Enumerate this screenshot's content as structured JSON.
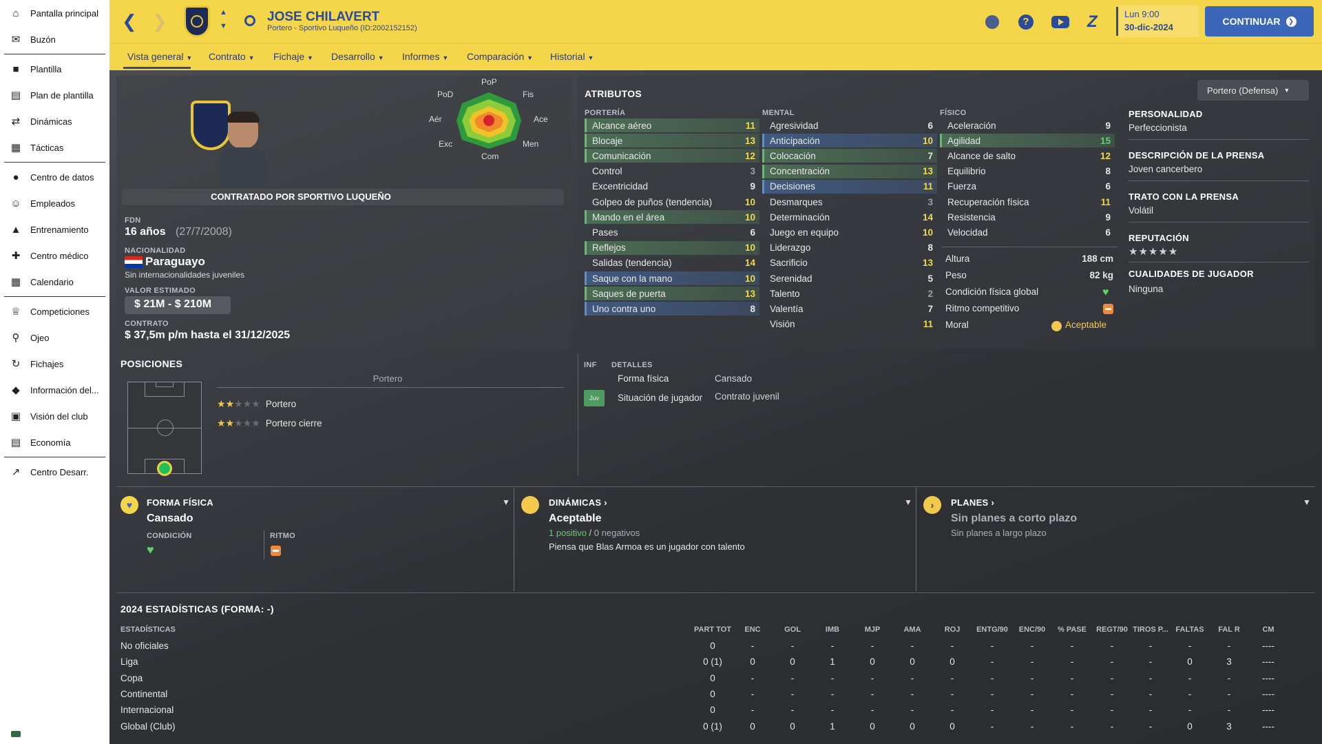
{
  "sidebar": {
    "items": [
      {
        "label": "Pantalla principal",
        "icon": "home-icon"
      },
      {
        "label": "Buzón",
        "icon": "inbox-icon"
      },
      {
        "label": "Plantilla",
        "icon": "shirt-icon"
      },
      {
        "label": "Plan de plantilla",
        "icon": "clipboard-icon"
      },
      {
        "label": "Dinámicas",
        "icon": "dynamics-icon"
      },
      {
        "label": "Tácticas",
        "icon": "tactics-icon"
      },
      {
        "label": "Centro de datos",
        "icon": "data-icon"
      },
      {
        "label": "Empleados",
        "icon": "staff-icon"
      },
      {
        "label": "Entrenamiento",
        "icon": "training-icon"
      },
      {
        "label": "Centro médico",
        "icon": "medical-icon"
      },
      {
        "label": "Calendario",
        "icon": "calendar-icon"
      },
      {
        "label": "Competiciones",
        "icon": "trophy-icon"
      },
      {
        "label": "Ojeo",
        "icon": "scouting-icon"
      },
      {
        "label": "Fichajes",
        "icon": "transfers-icon"
      },
      {
        "label": "Información del...",
        "icon": "club-info-icon"
      },
      {
        "label": "Visión del club",
        "icon": "vision-icon"
      },
      {
        "label": "Economía",
        "icon": "finance-icon"
      },
      {
        "label": "Centro Desarr.",
        "icon": "development-icon"
      }
    ]
  },
  "header": {
    "player_name": "JOSE CHILAVERT",
    "player_sub": "Portero - Sportivo Luqueño (ID:2002152152)",
    "date_time": "Lun 9:00",
    "date": "30-dic-2024",
    "continue_label": "CONTINUAR"
  },
  "tabs": [
    "Vista general",
    "Contrato",
    "Fichaje",
    "Desarrollo",
    "Informes",
    "Comparación",
    "Historial"
  ],
  "profile": {
    "contracted_by": "CONTRATADO POR SPORTIVO LUQUEÑO",
    "fdn_label": "FDN",
    "age": "16 años",
    "dob": "(27/7/2008)",
    "nat_label": "NACIONALIDAD",
    "nationality": "Paraguayo",
    "caps": "Sin internacionalidades juveniles",
    "value_label": "VALOR ESTIMADO",
    "value": "$ 21M - $ 210M",
    "contract_label": "CONTRATO",
    "contract": "$ 37,5m p/m hasta el 31/12/2025"
  },
  "radar": {
    "labels": [
      "PoP",
      "Fis",
      "Ace",
      "Men",
      "Com",
      "Exc",
      "Aér",
      "PoD"
    ]
  },
  "attributes": {
    "title": "ATRIBUTOS",
    "role_select": "Portero (Defensa)",
    "goalkeeping_label": "PORTERÍA",
    "mental_label": "MENTAL",
    "physical_label": "FÍSICO",
    "goalkeeping": [
      {
        "name": "Alcance aéreo",
        "value": "11",
        "hl": "green",
        "color": "y"
      },
      {
        "name": "Blocaje",
        "value": "13",
        "hl": "green",
        "color": "y"
      },
      {
        "name": "Comunicación",
        "value": "12",
        "hl": "green",
        "color": "y"
      },
      {
        "name": "Control",
        "value": "3",
        "hl": "",
        "color": "gr"
      },
      {
        "name": "Excentricidad",
        "value": "9",
        "hl": "",
        "color": "w"
      },
      {
        "name": "Golpeo de puños (tendencia)",
        "value": "10",
        "hl": "",
        "color": "y"
      },
      {
        "name": "Mando en el área",
        "value": "10",
        "hl": "green",
        "color": "y"
      },
      {
        "name": "Pases",
        "value": "6",
        "hl": "",
        "color": "w"
      },
      {
        "name": "Reflejos",
        "value": "10",
        "hl": "green",
        "color": "y"
      },
      {
        "name": "Salidas (tendencia)",
        "value": "14",
        "hl": "",
        "color": "y"
      },
      {
        "name": "Saque con la mano",
        "value": "10",
        "hl": "blue",
        "color": "y"
      },
      {
        "name": "Saques de puerta",
        "value": "13",
        "hl": "green",
        "color": "y"
      },
      {
        "name": "Uno contra uno",
        "value": "8",
        "hl": "blue",
        "color": "w"
      }
    ],
    "mental": [
      {
        "name": "Agresividad",
        "value": "6",
        "hl": "",
        "color": "w"
      },
      {
        "name": "Anticipación",
        "value": "10",
        "hl": "blue",
        "color": "y"
      },
      {
        "name": "Colocación",
        "value": "7",
        "hl": "green",
        "color": "w"
      },
      {
        "name": "Concentración",
        "value": "13",
        "hl": "green",
        "color": "y"
      },
      {
        "name": "Decisiones",
        "value": "11",
        "hl": "blue",
        "color": "y"
      },
      {
        "name": "Desmarques",
        "value": "3",
        "hl": "",
        "color": "gr"
      },
      {
        "name": "Determinación",
        "value": "14",
        "hl": "",
        "color": "y"
      },
      {
        "name": "Juego en equipo",
        "value": "10",
        "hl": "",
        "color": "y"
      },
      {
        "name": "Liderazgo",
        "value": "8",
        "hl": "",
        "color": "w"
      },
      {
        "name": "Sacrificio",
        "value": "13",
        "hl": "",
        "color": "y"
      },
      {
        "name": "Serenidad",
        "value": "5",
        "hl": "",
        "color": "w"
      },
      {
        "name": "Talento",
        "value": "2",
        "hl": "",
        "color": "gr"
      },
      {
        "name": "Valentía",
        "value": "7",
        "hl": "",
        "color": "w"
      },
      {
        "name": "Visión",
        "value": "11",
        "hl": "",
        "color": "y"
      }
    ],
    "physical": [
      {
        "name": "Aceleración",
        "value": "9",
        "hl": "",
        "color": "w"
      },
      {
        "name": "Agilidad",
        "value": "15",
        "hl": "green",
        "color": "g"
      },
      {
        "name": "Alcance de salto",
        "value": "12",
        "hl": "",
        "color": "y"
      },
      {
        "name": "Equilibrio",
        "value": "8",
        "hl": "",
        "color": "w"
      },
      {
        "name": "Fuerza",
        "value": "6",
        "hl": "",
        "color": "w"
      },
      {
        "name": "Recuperación física",
        "value": "11",
        "hl": "",
        "color": "y"
      },
      {
        "name": "Resistencia",
        "value": "9",
        "hl": "",
        "color": "w"
      },
      {
        "name": "Velocidad",
        "value": "6",
        "hl": "",
        "color": "w"
      }
    ],
    "height_label": "Altura",
    "height": "188 cm",
    "weight_label": "Peso",
    "weight": "82 kg",
    "condition_label": "Condición física global",
    "rhythm_label": "Ritmo competitivo",
    "morale_label": "Moral",
    "morale": "Aceptable"
  },
  "personality": {
    "personality_label": "PERSONALIDAD",
    "personality": "Perfeccionista",
    "press_desc_label": "DESCRIPCIÓN DE LA PRENSA",
    "press_desc": "Joven cancerbero",
    "press_handling_label": "TRATO CON LA PRENSA",
    "press_handling": "Volátil",
    "reputation_label": "REPUTACIÓN",
    "reputation_stars": 5,
    "qualities_label": "CUALIDADES DE JUGADOR",
    "qualities": "Ninguna"
  },
  "positions": {
    "title": "POSICIONES",
    "header": "Portero",
    "list": [
      {
        "name": "Portero",
        "stars": 2
      },
      {
        "name": "Portero cierre",
        "stars": 2
      }
    ]
  },
  "info": {
    "inf_label": "INF",
    "details_label": "DETALLES",
    "rows": [
      {
        "label": "Forma física",
        "value": "Cansado"
      },
      {
        "label": "Situación de jugador",
        "value": "Contrato juvenil"
      }
    ],
    "badge": "Juv"
  },
  "fitness_card": {
    "title": "FORMA FÍSICA",
    "state": "Cansado",
    "condition_label": "CONDICIÓN",
    "rhythm_label": "RITMO"
  },
  "dynamics_card": {
    "title": "DINÁMICAS",
    "state": "Aceptable",
    "positive": "1 positivo",
    "separator": "/",
    "negative": "0 negativos",
    "note": "Piensa que Blas Armoa es un jugador con talento"
  },
  "plans_card": {
    "title": "PLANES",
    "short": "Sin planes a corto plazo",
    "long": "Sin planes a largo plazo"
  },
  "stats": {
    "title": "2024 ESTADÍSTICAS (FORMA: -)",
    "row_header": "ESTADÍSTICAS",
    "columns": [
      "PART TOT",
      "ENC",
      "GOL",
      "IMB",
      "MJP",
      "AMA",
      "ROJ",
      "ENTG/90",
      "ENC/90",
      "% PASE",
      "REGT/90",
      "TIROS P...",
      "FALTAS",
      "FAL R",
      "CM"
    ],
    "rows": [
      {
        "name": "No oficiales",
        "values": [
          "0",
          "-",
          "-",
          "-",
          "-",
          "-",
          "-",
          "-",
          "-",
          "-",
          "-",
          "-",
          "-",
          "-",
          "----"
        ]
      },
      {
        "name": "Liga",
        "values": [
          "0 (1)",
          "0",
          "0",
          "1",
          "0",
          "0",
          "0",
          "-",
          "-",
          "-",
          "-",
          "-",
          "0",
          "3",
          "----"
        ]
      },
      {
        "name": "Copa",
        "values": [
          "0",
          "-",
          "-",
          "-",
          "-",
          "-",
          "-",
          "-",
          "-",
          "-",
          "-",
          "-",
          "-",
          "-",
          "----"
        ]
      },
      {
        "name": "Continental",
        "values": [
          "0",
          "-",
          "-",
          "-",
          "-",
          "-",
          "-",
          "-",
          "-",
          "-",
          "-",
          "-",
          "-",
          "-",
          "----"
        ]
      },
      {
        "name": "Internacional",
        "values": [
          "0",
          "-",
          "-",
          "-",
          "-",
          "-",
          "-",
          "-",
          "-",
          "-",
          "-",
          "-",
          "-",
          "-",
          "----"
        ]
      },
      {
        "name": "Global (Club)",
        "values": [
          "0 (1)",
          "0",
          "0",
          "1",
          "0",
          "0",
          "0",
          "-",
          "-",
          "-",
          "-",
          "-",
          "0",
          "3",
          "----"
        ]
      }
    ]
  },
  "colors": {
    "header_bg": "#f5d54a",
    "accent_blue": "#3a67b8",
    "good": "#62d16e",
    "warn": "#f2d94a"
  }
}
